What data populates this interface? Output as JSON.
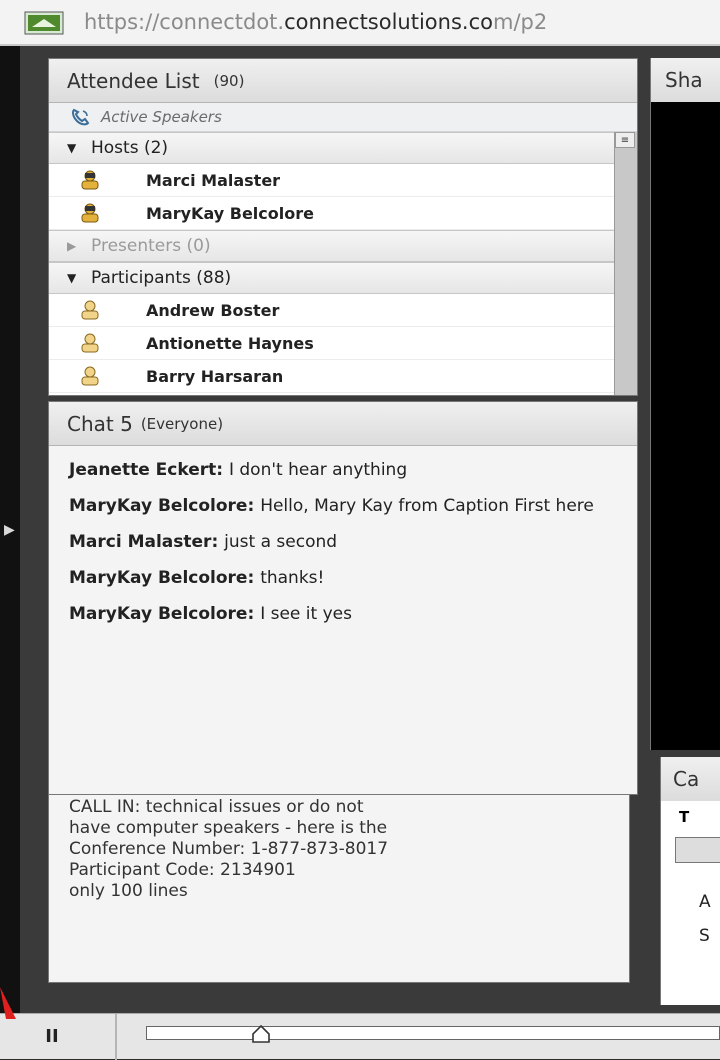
{
  "browser": {
    "url_dim_start": "https://",
    "url_dim_prefix": "connectdot.",
    "url_main": "connectsolutions.co",
    "url_tail": "m/p2"
  },
  "attendee_pod": {
    "title": "Attendee List",
    "count": "(90)",
    "active_speakers_label": "Active Speakers",
    "groups": {
      "hosts": {
        "label": "Hosts (2)",
        "members": [
          "Marci Malaster",
          "MaryKay Belcolore"
        ]
      },
      "presenters": {
        "label": "Presenters (0)"
      },
      "participants": {
        "label": "Participants (88)",
        "members": [
          "Andrew Boster",
          "Antionette Haynes",
          "Barry Harsaran"
        ]
      }
    }
  },
  "chat_pod": {
    "title": "Chat 5",
    "scope": "(Everyone)",
    "messages": [
      {
        "author": "Jeanette Eckert",
        "text": "I don't hear anything"
      },
      {
        "author": "MaryKay Belcolore",
        "text": "Hello, Mary Kay from Caption First here"
      },
      {
        "author": "Marci Malaster",
        "text": "just a second"
      },
      {
        "author": "MaryKay Belcolore",
        "text": "thanks!"
      },
      {
        "author": "MaryKay Belcolore",
        "text": "I see it yes"
      }
    ]
  },
  "note_pod": {
    "lines": [
      "CALL IN: technical issues or do not",
      "have computer speakers - here is the",
      "Conference Number: 1-877-873-8017",
      "Participant Code: 2134901",
      "only 100 lines"
    ]
  },
  "share_pod": {
    "title": "Sha"
  },
  "caption_pod": {
    "title": "Ca",
    "row_label": "T",
    "lines": [
      "A",
      "S"
    ]
  },
  "playback": {
    "pause_label": "II",
    "progress": 0.2
  },
  "colors": {
    "accent_mark": "#e0201e",
    "person_icon": "#e3b23c"
  }
}
